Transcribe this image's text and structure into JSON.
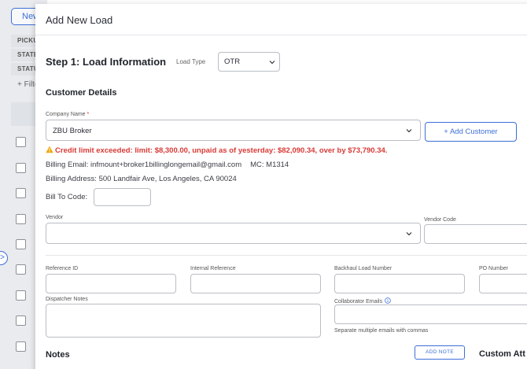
{
  "background": {
    "new_button": "New",
    "chips": [
      "PICKU",
      "STATE",
      "STATU"
    ],
    "filter_label": "+ Filte",
    "toggle_glyph": ">"
  },
  "modal": {
    "title": "Add New Load",
    "step_title": "Step 1: Load Information",
    "load_type": {
      "label": "Load Type",
      "value": "OTR"
    }
  },
  "customer": {
    "section_title": "Customer Details",
    "company_name_label": "Company Name",
    "required_mark": "*",
    "company_name_value": "ZBU Broker",
    "add_customer_label": "+ Add Customer",
    "credit_warning": "Credit limit exceeded: limit: $8,300.00, unpaid as of yesterday: $82,090.34, over by $73,790.34.",
    "billing_email": "Billing Email: infmount+broker1billinglongemail@gmail.com",
    "mc": "MC: M1314",
    "billing_address": "Billing Address: 500 Landfair Ave, Los Angeles, CA 90024",
    "bill_to_code_label": "Bill To Code:",
    "vendor_label": "Vendor",
    "vendor_code_label": "Vendor Code"
  },
  "references": {
    "reference_id_label": "Reference ID",
    "internal_reference_label": "Internal Reference",
    "backhaul_label": "Backhaul Load Number",
    "po_label": "PO Number",
    "dispatcher_notes_label": "Dispatcher Notes",
    "collaborator_emails_label": "Collaborator Emails",
    "collaborator_help": "Separate multiple emails with commas"
  },
  "notes": {
    "title": "Notes",
    "add_note_label": "ADD NOTE",
    "custom_title": "Custom Att"
  },
  "colors": {
    "accent": "#3d6fd8",
    "warning": "#d83a36"
  },
  "icons": [
    "chevron-down-icon",
    "warning-icon",
    "info-icon",
    "chevron-right-icon"
  ]
}
